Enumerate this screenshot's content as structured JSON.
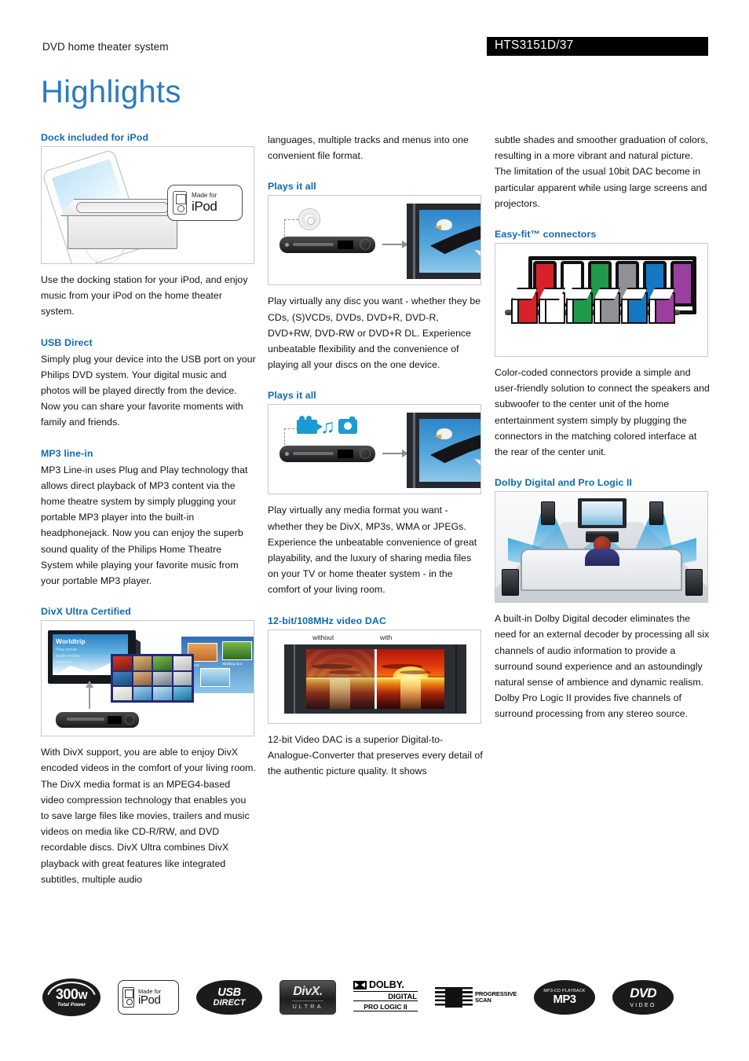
{
  "header": {
    "subtitle": "DVD home theater system",
    "model": "HTS3151D/37",
    "title": "Highlights"
  },
  "columns": [
    {
      "sections": [
        {
          "heading": "Dock included for iPod",
          "image": {
            "name": "ipod-dock-illustration",
            "badge": {
              "small": "Made for",
              "big": "iPod"
            }
          },
          "body": "Use the docking station for your iPod, and enjoy music from your iPod on the home theater system."
        },
        {
          "heading": "USB Direct",
          "body": "Simply plug your device into the USB port on your Philips DVD system. Your digital music and photos will be played directly from the device. Now you can share your favorite moments with family and friends."
        },
        {
          "heading": "MP3 line-in",
          "body": "MP3 Line-in uses Plug and Play technology that allows direct playback of MP3 content via the home theatre system by simply plugging your portable MP3 player into the built-in headphonejack. Now you can enjoy the superb sound quality of the Philips Home Theatre System while playing your favorite music from your portable MP3 player."
        },
        {
          "heading": "DivX Ultra Certified",
          "image": {
            "name": "divx-ultra-illustration",
            "tv_title": "Worldtrip",
            "tv_menu": [
              "Play movie",
              "Audio extras",
              "Subtitles"
            ],
            "photo_labels": [
              "Desert",
              "Walking tour"
            ]
          },
          "body": "With DivX support, you are able to enjoy DivX encoded videos in the comfort of your living room. The DivX media format is an MPEG4-based video compression technology that enables you to save large files like movies, trailers and music videos on media like CD-R/RW, and DVD recordable discs. DivX Ultra combines DivX playback with great features like integrated subtitles, multiple audio"
        }
      ]
    },
    {
      "sections": [
        {
          "heading": "",
          "body": "languages, multiple tracks and menus into one convenient file format."
        },
        {
          "heading": "Plays it all",
          "image": {
            "name": "plays-disc-illustration"
          },
          "body": "Play virtually any disc you want - whether they be CDs, (S)VCDs, DVDs, DVD+R, DVD-R, DVD+RW, DVD-RW or DVD+R DL. Experience unbeatable flexibility and the convenience of playing all your discs on the one device."
        },
        {
          "heading": "Plays it all",
          "image": {
            "name": "plays-media-illustration"
          },
          "body": "Play virtually any media format you want - whether they be DivX, MP3s, WMA or JPEGs. Experience the unbeatable convenience of great playability, and the luxury of sharing media files on your TV or home theater system - in the comfort of your living room."
        },
        {
          "heading": "12-bit/108MHz video DAC",
          "image": {
            "name": "video-dac-comparison",
            "label_left": "without",
            "label_right": "with"
          },
          "body": "12-bit Video DAC is a superior Digital-to-Analogue-Converter that preserves every detail of the authentic picture quality. It shows"
        }
      ]
    },
    {
      "sections": [
        {
          "heading": "",
          "body": "subtle shades and smoother graduation of colors, resulting in a more vibrant and natural picture. The limitation of the usual 10bit DAC become in particular apparent while using large screens and projectors."
        },
        {
          "heading": "Easy-fit™ connectors",
          "image": {
            "name": "easyfit-connectors-illustration",
            "connector_colors": [
              "#d8222a",
              "#ffffff",
              "#1f9a4a",
              "#8e9296",
              "#1479c4",
              "#9b3fa0"
            ]
          },
          "body": "Color-coded connectors provide a simple and user-friendly solution to connect the speakers and subwoofer to the center unit of the home entertainment system simply by plugging the connectors in the matching colored interface at the rear of the center unit."
        },
        {
          "heading": "Dolby Digital and Pro Logic II",
          "image": {
            "name": "dolby-surround-room-illustration"
          },
          "body": "A built-in Dolby Digital decoder eliminates the need for an external decoder by processing all six channels of audio information to provide a surround sound experience and an astoundingly natural sense of ambience and dynamic realism. Dolby Pro Logic II provides five channels of surround processing from any stereo source."
        }
      ]
    }
  ],
  "footer_logos": [
    {
      "name": "power-300w-logo",
      "power": "300",
      "unit": "W",
      "caption": "Total Power"
    },
    {
      "name": "made-for-ipod-logo",
      "small": "Made for",
      "big": "iPod"
    },
    {
      "name": "usb-direct-logo",
      "top": "USB",
      "bottom": "DIRECT"
    },
    {
      "name": "divx-ultra-logo",
      "top": "DivX.",
      "bottom": "ULTRA"
    },
    {
      "name": "dolby-digital-prologic-logo",
      "l1": "DOLBY.",
      "l2": "DIGITAL",
      "l3": "PRO LOGIC II"
    },
    {
      "name": "progressive-scan-logo",
      "l1": "PROGRESSIVE",
      "l2": "SCAN"
    },
    {
      "name": "mp3-cd-playback-logo",
      "caption": "MP3-CD PLAYBACK",
      "big": "MP3"
    },
    {
      "name": "dvd-video-logo",
      "big": "DVD",
      "sub": "VIDEO"
    }
  ],
  "theme": {
    "accent_blue": "#0f6ab0",
    "title_blue": "#2b7cc0",
    "model_bar_bg": "#000000"
  }
}
